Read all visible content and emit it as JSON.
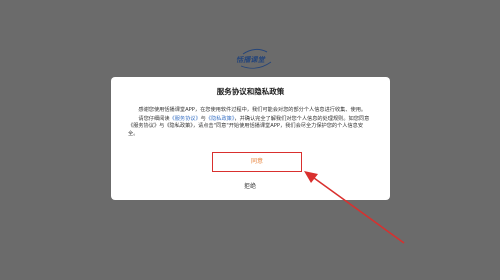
{
  "background": {
    "color": "#6b6b6b"
  },
  "logo": {
    "text": "恬播课堂",
    "color": "#25457a"
  },
  "dialog": {
    "title": "服务协议和隐私政策",
    "para1": "感谢您使用恬播课堂APP，在您使用软件过程中，我们可能会对您的部分个人信息进行收集、使用。",
    "para2_part1": "请您仔细阅读",
    "service_agreement_link": "《服务协议》",
    "and": "与",
    "privacy_policy_link": "《隐私政策》",
    "para2_part2": "，并确认完全了解我们对您个人信息的处理规则。如您同意《服务协议》与《隐私政策》，请点击\"同意\"开始使用恬播课堂APP，我们会尽全力保护您的个人信息安全。",
    "agree_label": "同意",
    "reject_label": "拒绝"
  },
  "colors": {
    "link": "#3b73c5",
    "agree_text": "#e8833a",
    "highlight": "#d9302e"
  }
}
